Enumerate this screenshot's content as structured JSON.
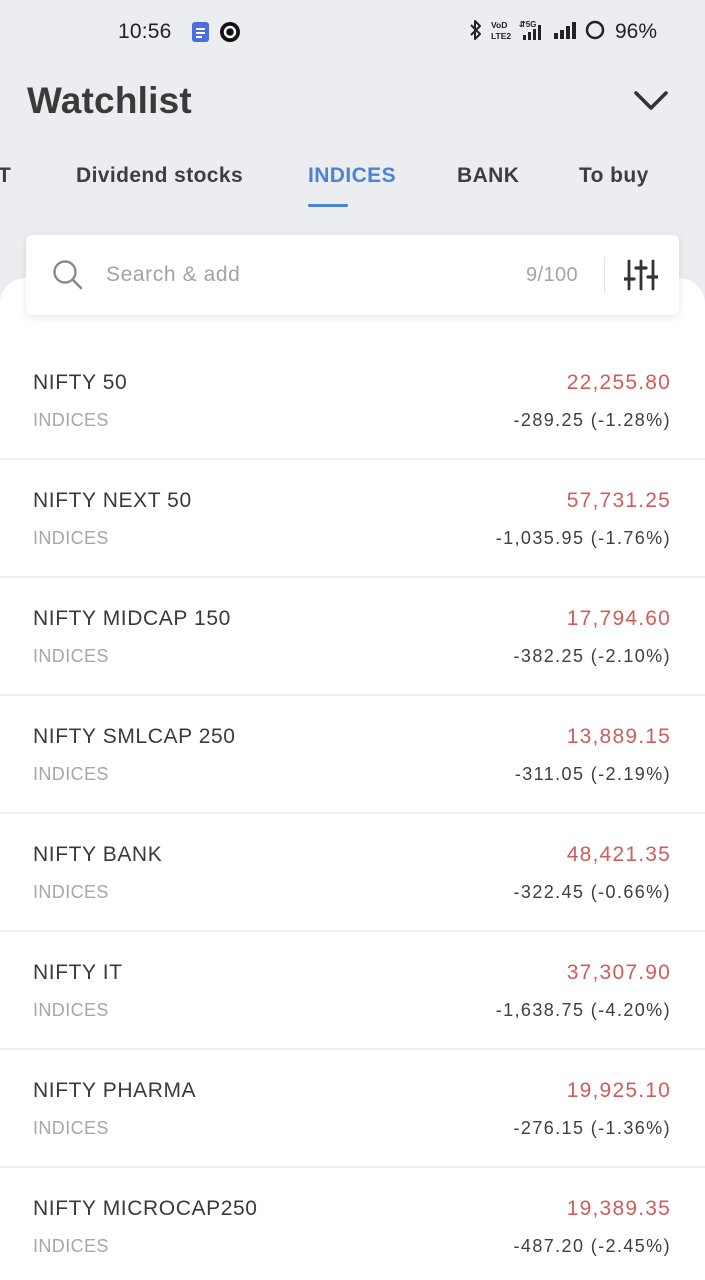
{
  "status_bar": {
    "time": "10:56",
    "battery": "96%",
    "icons": [
      "notes-icon",
      "ring-icon",
      "bluetooth-icon",
      "volte-icon",
      "5g-signal-icon",
      "signal-icon",
      "battery-ring-icon"
    ]
  },
  "header": {
    "title": "Watchlist",
    "chevron_icon": "chevron-down-icon"
  },
  "tabs": [
    {
      "label": "T",
      "active": false
    },
    {
      "label": "Dividend stocks",
      "active": false
    },
    {
      "label": "INDICES",
      "active": true
    },
    {
      "label": "BANK",
      "active": false
    },
    {
      "label": "To buy",
      "active": false
    }
  ],
  "search": {
    "placeholder": "Search & add",
    "value": "",
    "count": "9/100",
    "search_icon": "search-icon",
    "filter_icon": "filter-sliders-icon"
  },
  "items": [
    {
      "name": "NIFTY 50",
      "exchange": "INDICES",
      "price": "22,255.80",
      "change": "-289.25 (-1.28%)"
    },
    {
      "name": "NIFTY NEXT 50",
      "exchange": "INDICES",
      "price": "57,731.25",
      "change": "-1,035.95 (-1.76%)"
    },
    {
      "name": "NIFTY MIDCAP 150",
      "exchange": "INDICES",
      "price": "17,794.60",
      "change": "-382.25 (-2.10%)"
    },
    {
      "name": "NIFTY SMLCAP 250",
      "exchange": "INDICES",
      "price": "13,889.15",
      "change": "-311.05 (-2.19%)"
    },
    {
      "name": "NIFTY BANK",
      "exchange": "INDICES",
      "price": "48,421.35",
      "change": "-322.45 (-0.66%)"
    },
    {
      "name": "NIFTY IT",
      "exchange": "INDICES",
      "price": "37,307.90",
      "change": "-1,638.75 (-4.20%)"
    },
    {
      "name": "NIFTY PHARMA",
      "exchange": "INDICES",
      "price": "19,925.10",
      "change": "-276.15 (-1.36%)"
    },
    {
      "name": "NIFTY MICROCAP250",
      "exchange": "INDICES",
      "price": "19,389.35",
      "change": "-487.20 (-2.45%)"
    }
  ],
  "colors": {
    "accent": "#4a84d6",
    "price_down": "#d05c5c",
    "background": "#ebedf0"
  }
}
